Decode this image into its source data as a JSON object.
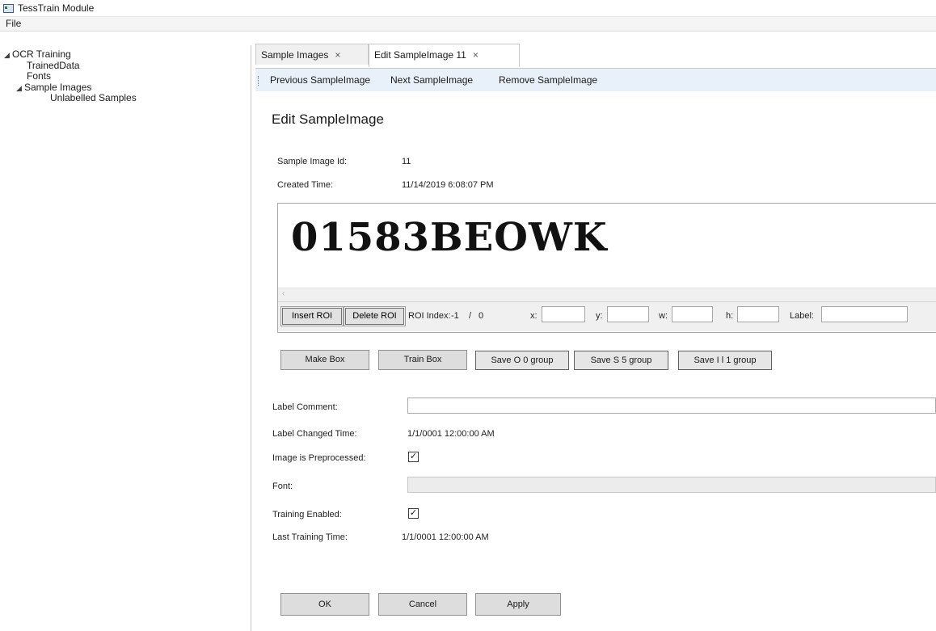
{
  "window": {
    "title": "TessTrain Module"
  },
  "menu": {
    "file": "File"
  },
  "tree": {
    "root": "OCR Training",
    "children": [
      "TrainedData",
      "Fonts",
      "Sample Images"
    ],
    "sample_child": "Unlabelled Samples"
  },
  "tabs": [
    {
      "label": "Sample Images",
      "close": "×"
    },
    {
      "label": "Edit SampleImage 11",
      "close": "×"
    }
  ],
  "toolbar": {
    "previous": "Previous SampleImage",
    "next": "Next SampleImage",
    "remove": "Remove SampleImage"
  },
  "form": {
    "heading": "Edit SampleImage",
    "id_label": "Sample Image Id:",
    "id_value": "11",
    "created_label": "Created Time:",
    "created_value": "11/14/2019 6:08:07 PM",
    "image_text": "01583BEOWK",
    "scroll_arrow": "‹",
    "roi": {
      "insert": "Insert ROI",
      "delete": "Delete ROI",
      "index_label": "ROI Index:",
      "index_value": "-1",
      "index_sep": "/",
      "index_total": "0",
      "x_label": "x:",
      "y_label": "y:",
      "w_label": "w:",
      "h_label": "h:",
      "label_label": "Label:",
      "x": "",
      "y": "",
      "w": "",
      "h": "",
      "label": ""
    },
    "actions": {
      "make_box": "Make Box",
      "train_box": "Train Box",
      "save_o": "Save O 0 group",
      "save_s": "Save S 5 group",
      "save_i": "Save I l 1 group"
    },
    "label_comment_label": "Label Comment:",
    "label_comment_value": "",
    "label_changed_label": "Label Changed Time:",
    "label_changed_value": "1/1/0001 12:00:00 AM",
    "preprocessed_label": "Image is Preprocessed:",
    "preprocessed_checked": true,
    "font_label": "Font:",
    "font_value": "",
    "training_enabled_label": "Training Enabled:",
    "training_enabled_checked": true,
    "last_training_label": "Last Training Time:",
    "last_training_value": "1/1/0001 12:00:00 AM",
    "checkmark": "✓"
  },
  "dialog_buttons": {
    "ok": "OK",
    "cancel": "Cancel",
    "apply": "Apply"
  }
}
